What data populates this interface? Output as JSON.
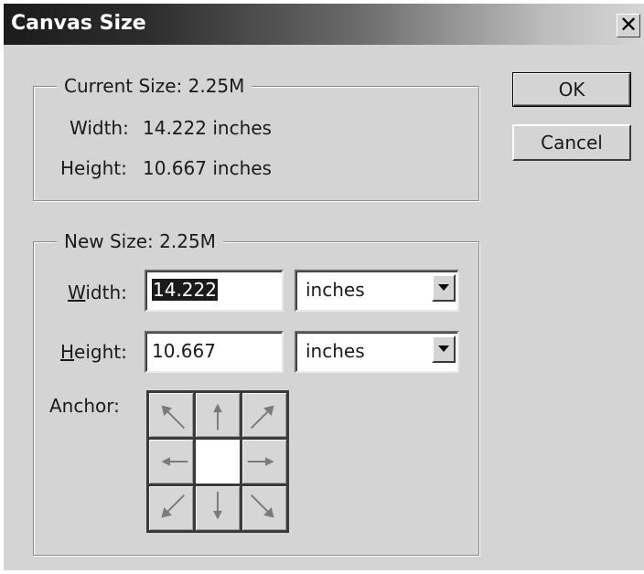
{
  "window": {
    "title": "Canvas Size",
    "close_glyph": "✕"
  },
  "buttons": {
    "ok": "OK",
    "cancel": "Cancel"
  },
  "current_size": {
    "legend": "Current Size:  2.25M",
    "width_label": "Width:",
    "width_value": "14.222 inches",
    "height_label": "Height:",
    "height_value": "10.667 inches"
  },
  "new_size": {
    "legend": "New Size:  2.25M",
    "width_label_u": "W",
    "width_label_rest": "idth:",
    "width_value": "14.222",
    "width_unit": "inches",
    "height_label_u": "H",
    "height_label_rest": "eight:",
    "height_value": "10.667",
    "height_unit": "inches",
    "anchor_label": "Anchor:"
  },
  "anchor": {
    "selected": "center",
    "arrow_color": "#7a7a7a",
    "cells": [
      {
        "name": "anchor-top-left",
        "icon": "arrow-up-left-icon"
      },
      {
        "name": "anchor-top-center",
        "icon": "arrow-up-icon"
      },
      {
        "name": "anchor-top-right",
        "icon": "arrow-up-right-icon"
      },
      {
        "name": "anchor-middle-left",
        "icon": "arrow-left-icon"
      },
      {
        "name": "anchor-center",
        "icon": "none"
      },
      {
        "name": "anchor-middle-right",
        "icon": "arrow-right-icon"
      },
      {
        "name": "anchor-bottom-left",
        "icon": "arrow-down-left-icon"
      },
      {
        "name": "anchor-bottom-center",
        "icon": "arrow-down-icon"
      },
      {
        "name": "anchor-bottom-right",
        "icon": "arrow-down-right-icon"
      }
    ]
  }
}
